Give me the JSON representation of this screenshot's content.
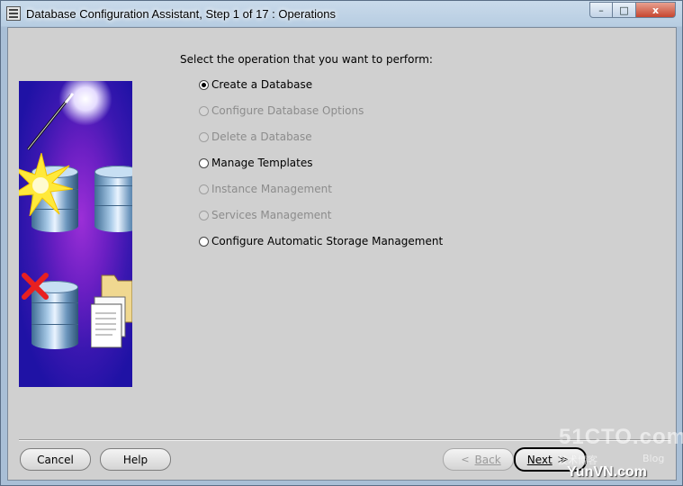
{
  "window": {
    "title": "Database Configuration Assistant, Step 1 of 17 : Operations",
    "controls": {
      "minimize": "–",
      "maximize": "□",
      "close": "x"
    }
  },
  "main": {
    "prompt": "Select the operation that you want to perform:",
    "options": [
      {
        "label": "Create a Database",
        "checked": true,
        "enabled": true
      },
      {
        "label": "Configure Database Options",
        "checked": false,
        "enabled": false
      },
      {
        "label": "Delete a Database",
        "checked": false,
        "enabled": false
      },
      {
        "label": "Manage Templates",
        "checked": false,
        "enabled": true
      },
      {
        "label": "Instance Management",
        "checked": false,
        "enabled": false
      },
      {
        "label": "Services Management",
        "checked": false,
        "enabled": false
      },
      {
        "label": "Configure Automatic Storage Management",
        "checked": false,
        "enabled": true
      }
    ]
  },
  "buttons": {
    "cancel": "Cancel",
    "help": "Help",
    "back": "Back",
    "next": "Next",
    "back_arrow": "<",
    "next_arrow": "≫"
  },
  "watermark": {
    "site": "51CTO.com",
    "sub1": "技术博客",
    "sub2": "Blog",
    "site2": "YunVN.com"
  },
  "colors": {
    "client_bg": "#d0d0d0",
    "illustration_bg": "#3a17b0",
    "check_red": "#d42020"
  }
}
